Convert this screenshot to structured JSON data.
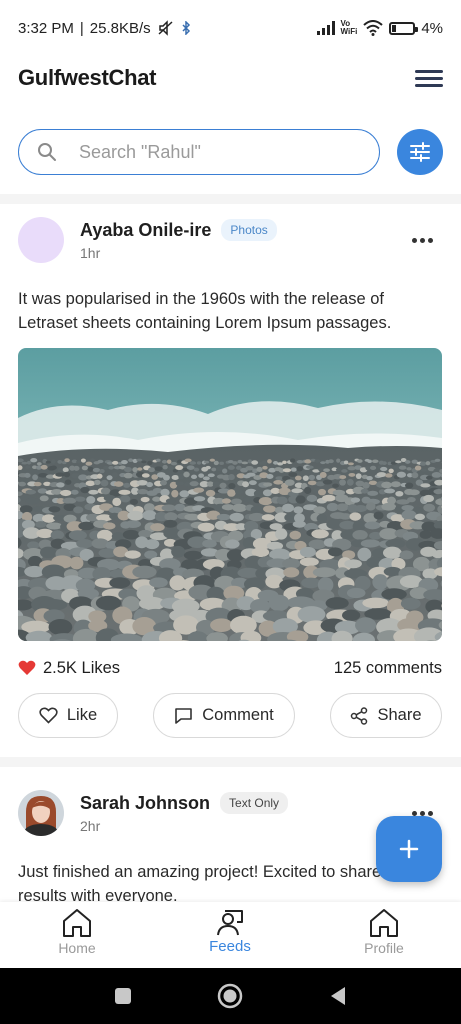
{
  "status_bar": {
    "time": "3:32 PM",
    "separator": "|",
    "net_speed": "25.8KB/s",
    "battery_text": "4%",
    "battery_level": 0.04,
    "wifi_label_top": "Vo",
    "wifi_label_bottom": "WiFi"
  },
  "header": {
    "title": "GulfwestChat",
    "menu_icon": "hamburger-menu-icon"
  },
  "search": {
    "placeholder": "Search \"Rahul\"",
    "value": "",
    "filter_icon": "sliders-icon"
  },
  "posts": [
    {
      "author": "Ayaba Onile-ire",
      "badge": "Photos",
      "time": "1hr",
      "text": "It was popularised in the 1960s with the release of Letraset sheets containing Lorem Ipsum passages.",
      "image": "pebble-beach-photo",
      "likes": "2.5K Likes",
      "comments": "125 comments",
      "actions": {
        "like": "Like",
        "comment": "Comment",
        "share": "Share"
      }
    },
    {
      "author": "Sarah Johnson",
      "badge": "Text Only",
      "time": "2hr",
      "text": "Just finished an amazing project! Excited to share the results with everyone."
    }
  ],
  "fab": {
    "icon": "plus-icon"
  },
  "bottom_nav": {
    "items": [
      {
        "label": "Home",
        "icon": "home-icon",
        "active": false
      },
      {
        "label": "Feeds",
        "icon": "users-icon",
        "active": true
      },
      {
        "label": "Profile",
        "icon": "home-icon",
        "active": false
      }
    ]
  },
  "colors": {
    "accent": "#3a86de",
    "like_heart": "#e53935",
    "avatar_placeholder": "#e9dcfa"
  }
}
